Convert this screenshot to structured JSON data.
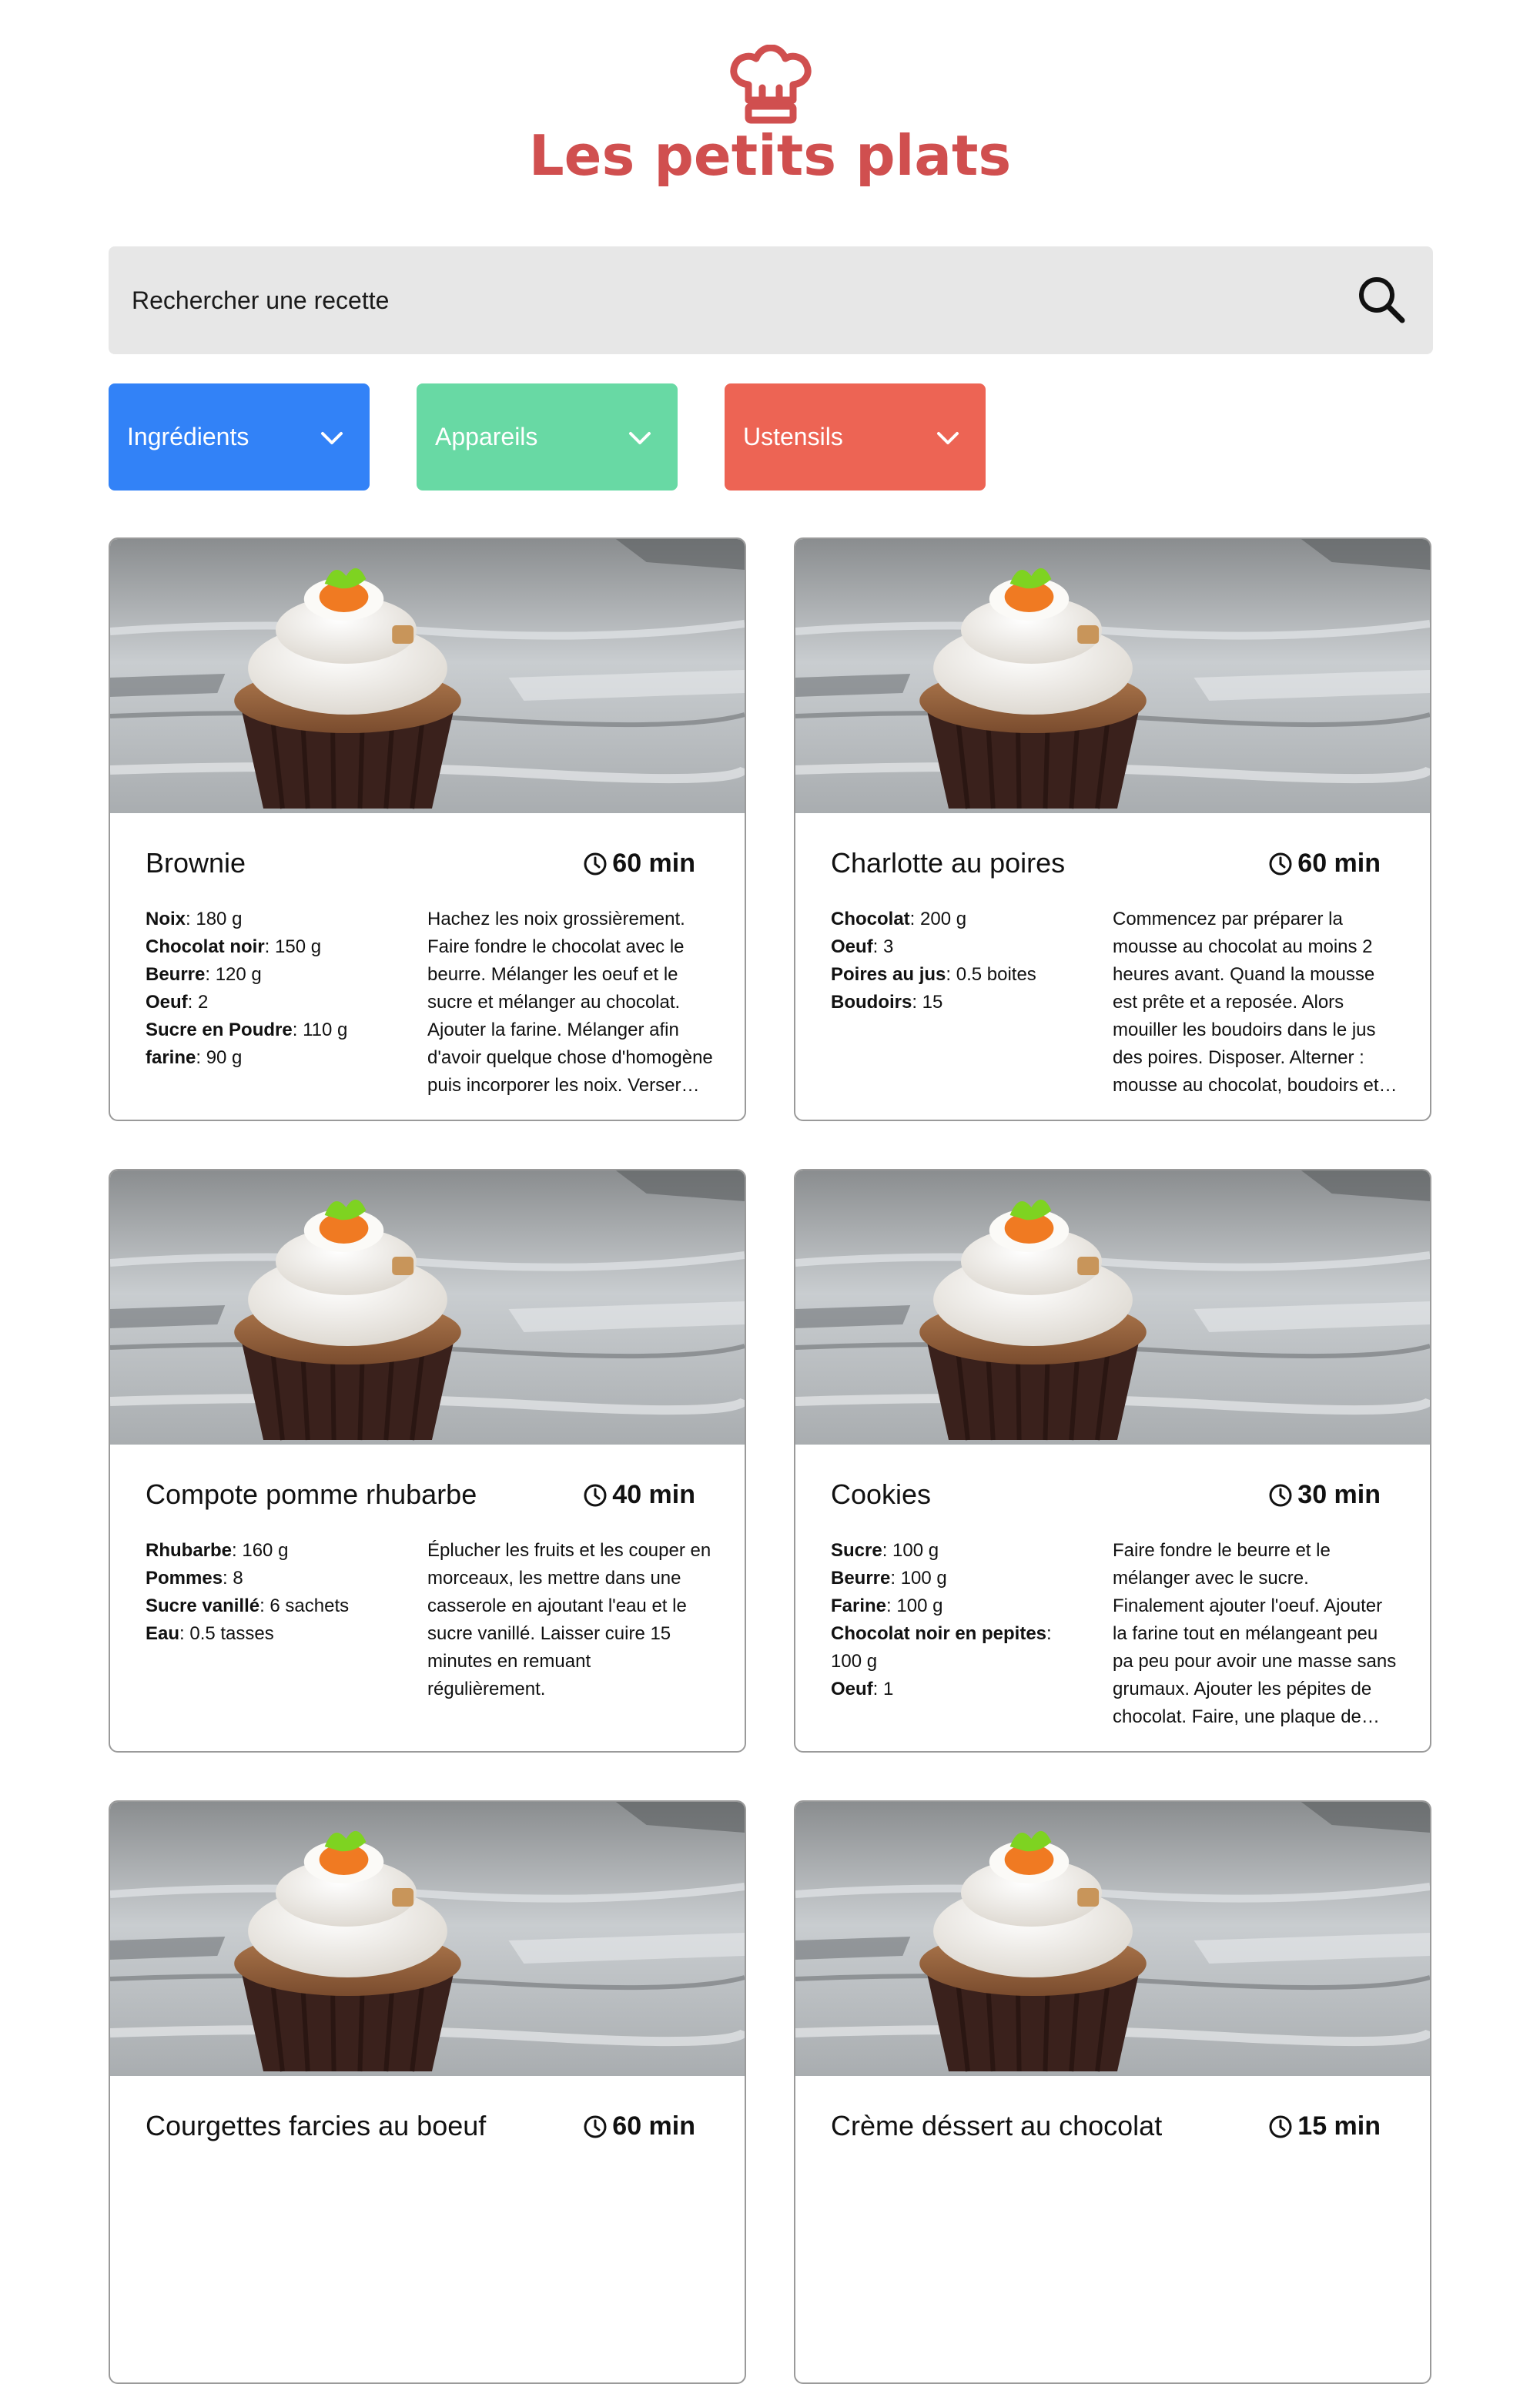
{
  "brand": {
    "title": "Les petits plats",
    "logo_icon": "chef-hat-icon",
    "color": "#d04f4f"
  },
  "search": {
    "placeholder": "Rechercher une recette",
    "value": "",
    "icon": "search-icon"
  },
  "filters": [
    {
      "label": "Ingrédients",
      "color": "#3282f7",
      "icon": "chevron-down-icon"
    },
    {
      "label": "Appareils",
      "color": "#68d9a4",
      "icon": "chevron-down-icon"
    },
    {
      "label": "Ustensils",
      "color": "#ed6454",
      "icon": "chevron-down-icon"
    }
  ],
  "recipes": [
    {
      "name": "Brownie",
      "time": "60 min",
      "ingredients": [
        {
          "name": "Noix",
          "qty": ": 180 g"
        },
        {
          "name": "Chocolat noir",
          "qty": ": 150 g"
        },
        {
          "name": "Beurre",
          "qty": ": 120 g"
        },
        {
          "name": "Oeuf",
          "qty": ": 2"
        },
        {
          "name": "Sucre en Poudre",
          "qty": ": 110 g"
        },
        {
          "name": "farine",
          "qty": ": 90 g"
        }
      ],
      "description": "Hachez les noix grossièrement. Faire fondre le chocolat avec le beurre. Mélanger les oeuf et le sucre et mélanger au chocolat. Ajouter la farine. Mélanger afin d'avoir quelque chose d'homogène puis incorporer les noix. Verser la…"
    },
    {
      "name": "Charlotte au poires",
      "time": "60 min",
      "ingredients": [
        {
          "name": "Chocolat",
          "qty": ": 200 g"
        },
        {
          "name": "Oeuf",
          "qty": ": 3"
        },
        {
          "name": "Poires au jus",
          "qty": ": 0.5 boites"
        },
        {
          "name": "Boudoirs",
          "qty": ": 15"
        }
      ],
      "description": "Commencez par préparer la mousse au chocolat au moins 2 heures avant. Quand la mousse est prête et a reposée. Alors mouiller les boudoirs dans le jus des poires. Disposer. Alterner : mousse au chocolat, boudoirs et poires.…"
    },
    {
      "name": "Compote pomme rhubarbe",
      "time": "40 min",
      "ingredients": [
        {
          "name": "Rhubarbe",
          "qty": ": 160 g"
        },
        {
          "name": "Pommes",
          "qty": ": 8"
        },
        {
          "name": "Sucre vanillé",
          "qty": ": 6 sachets"
        },
        {
          "name": "Eau",
          "qty": ": 0.5 tasses"
        }
      ],
      "description": "Éplucher les fruits et les couper en morceaux, les mettre dans une casserole en ajoutant l'eau et le sucre vanillé. Laisser cuire 15 minutes en remuant régulièrement."
    },
    {
      "name": "Cookies",
      "time": "30 min",
      "ingredients": [
        {
          "name": "Sucre",
          "qty": ": 100 g"
        },
        {
          "name": "Beurre",
          "qty": ": 100 g"
        },
        {
          "name": "Farine",
          "qty": ": 100 g"
        },
        {
          "name": "Chocolat noir en pepites",
          "qty": ": 100 g"
        },
        {
          "name": "Oeuf",
          "qty": ": 1"
        }
      ],
      "description": "Faire fondre le beurre et le mélanger avec le sucre. Finalement ajouter l'oeuf. Ajouter la farine tout en mélangeant peu pa peu pour avoir une masse sans grumaux. Ajouter les pépites de chocolat. Faire, une plaque de cuisson de…"
    },
    {
      "name": "Courgettes farcies au boeuf",
      "time": "60 min",
      "ingredients": [],
      "description": ""
    },
    {
      "name": "Crème déssert au chocolat",
      "time": "15 min",
      "ingredients": [],
      "description": ""
    }
  ]
}
